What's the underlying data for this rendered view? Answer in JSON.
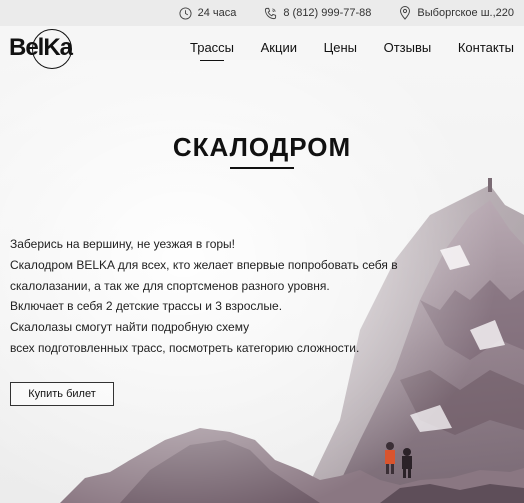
{
  "topbar": {
    "hours": "24 часа",
    "phone": "8 (812) 999-77-88",
    "address": "Выборгское ш.,220"
  },
  "logo": {
    "text": "BelKa"
  },
  "nav": {
    "items": [
      {
        "label": "Трассы"
      },
      {
        "label": "Акции"
      },
      {
        "label": "Цены"
      },
      {
        "label": "Отзывы"
      },
      {
        "label": "Контакты"
      }
    ]
  },
  "hero": {
    "title": "СКАЛОДРОМ",
    "description": [
      "Заберись на вершину, не уезжая в горы!",
      "Скалодром BELKA для всех, кто желает впервые попробовать себя в",
      "скалолазании, а так же для спортсменов разного уровня.",
      "Включает в себя 2 детские трассы и 3 взрослые.",
      "Скалолазы смогут найти подробную схему",
      "всех подготовленных трасс, посмотреть категорию сложности."
    ],
    "buy_button": "Купить билет"
  }
}
